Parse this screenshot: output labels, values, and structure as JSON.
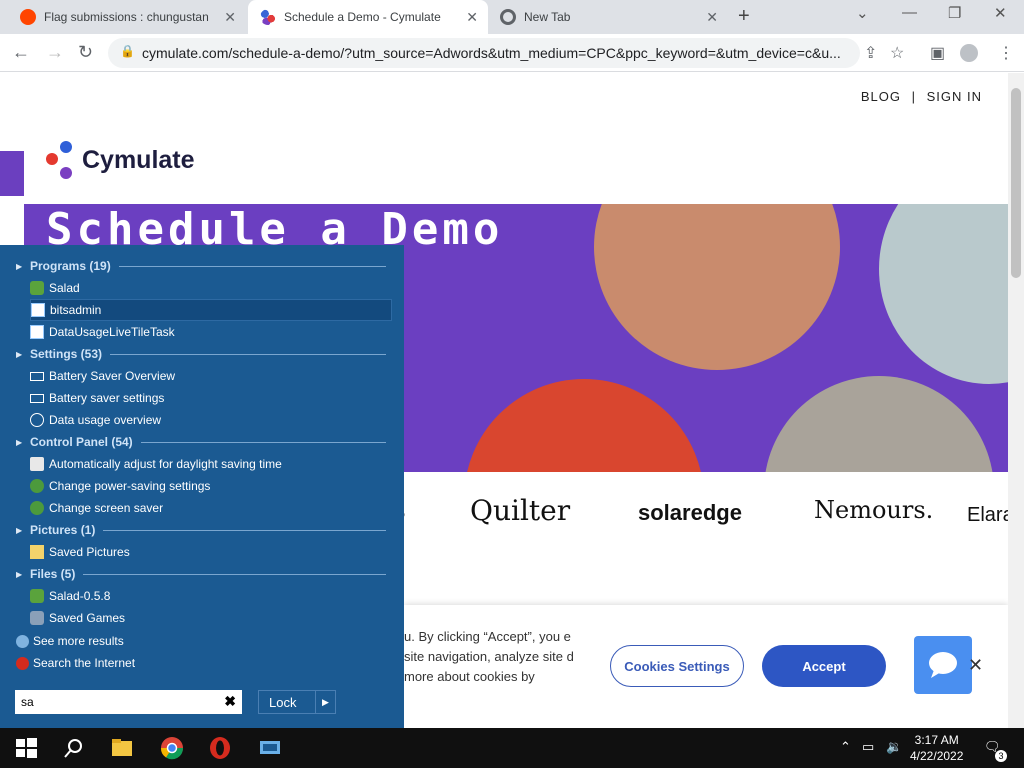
{
  "browser": {
    "tabs": [
      {
        "title": "Flag submissions : chungustan",
        "favicon_color": "#ff4500"
      },
      {
        "title": "Schedule a Demo - Cymulate",
        "favicon_color": "#5b2ea6"
      },
      {
        "title": "New Tab",
        "favicon_color": "#5f6368"
      }
    ],
    "url": "cymulate.com/schedule-a-demo/?utm_source=Adwords&utm_medium=CPC&ppc_keyword=&utm_device=c&u..."
  },
  "page": {
    "topnav": {
      "blog": "BLOG",
      "separator": "|",
      "signin": "SIGN IN"
    },
    "logo_text": "Cymulate",
    "hero_title": "Schedule a Demo",
    "brands": [
      "s",
      "Quilter",
      "solaredge",
      "Nemours.",
      "Elara"
    ],
    "cookie": {
      "text": "u. By clicking “Accept”, you e site navigation, analyze site d more about cookies by",
      "settings_label": "Cookies Settings",
      "accept_label": "Accept"
    }
  },
  "search": {
    "groups": [
      {
        "header": "Programs (19)",
        "items": [
          "Salad",
          "bitsadmin",
          "DataUsageLiveTileTask"
        ]
      },
      {
        "header": "Settings (53)",
        "items": [
          "Battery Saver Overview",
          "Battery saver settings",
          "Data usage overview"
        ]
      },
      {
        "header": "Control Panel (54)",
        "items": [
          "Automatically adjust for daylight saving time",
          "Change power-saving settings",
          "Change screen saver"
        ]
      },
      {
        "header": "Pictures (1)",
        "items": [
          "Saved Pictures"
        ]
      },
      {
        "header": "Files (5)",
        "items": [
          "Salad-0.5.8",
          "Saved Games"
        ]
      }
    ],
    "see_more": "See more results",
    "search_internet": "Search the Internet",
    "query": "sa",
    "lock_label": "Lock"
  },
  "taskbar": {
    "time": "3:17 AM",
    "date": "4/22/2022",
    "notification_count": "3"
  }
}
